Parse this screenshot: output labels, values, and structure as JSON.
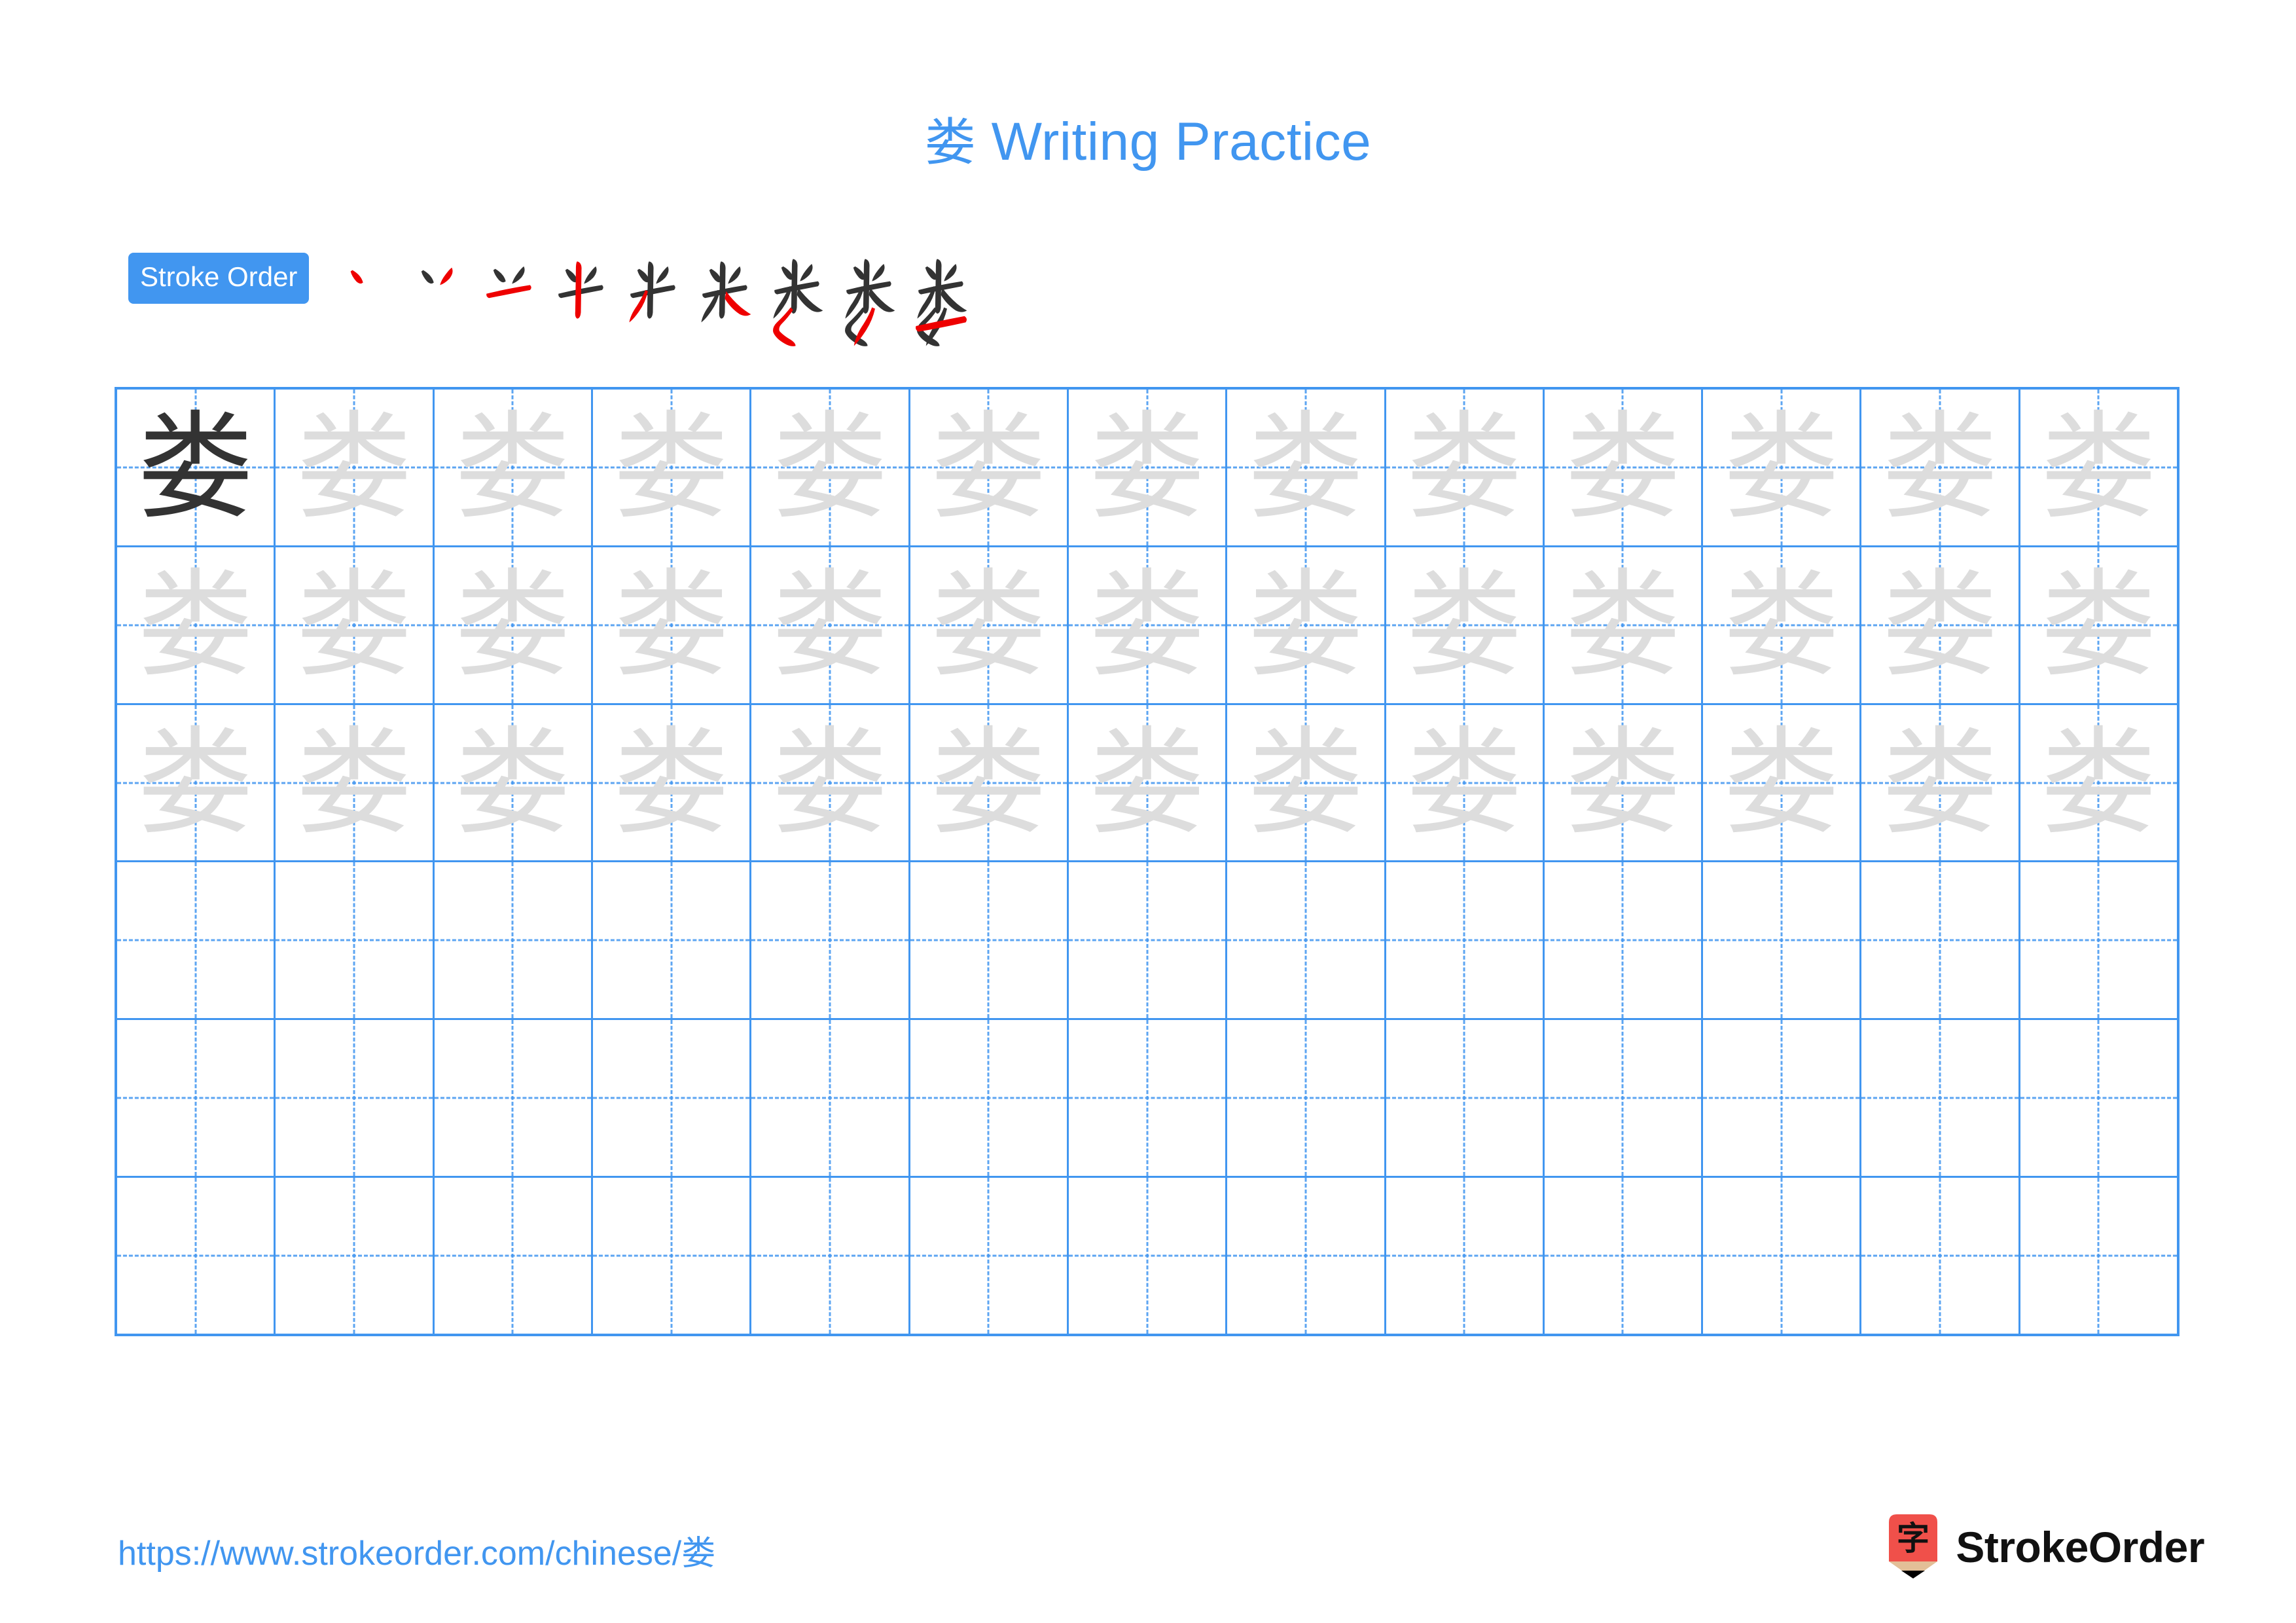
{
  "page": {
    "character": "娄",
    "title_text": "娄 Writing Practice",
    "title_char": "娄",
    "title_suffix": " Writing Practice",
    "accent_color": "#4196f0",
    "stroke_new_color": "#ee0000",
    "stroke_done_color": "#333333",
    "template_char_color": "#dddddd",
    "model_char_color": "#333333"
  },
  "stroke_order": {
    "badge_label": "Stroke Order",
    "total_strokes": 9,
    "steps": [
      {
        "index": 1,
        "label": "stroke-1",
        "new_stroke_name": "dian"
      },
      {
        "index": 2,
        "label": "stroke-2",
        "new_stroke_name": "dian"
      },
      {
        "index": 3,
        "label": "stroke-3",
        "new_stroke_name": "heng"
      },
      {
        "index": 4,
        "label": "stroke-4",
        "new_stroke_name": "shu"
      },
      {
        "index": 5,
        "label": "stroke-5",
        "new_stroke_name": "pie"
      },
      {
        "index": 6,
        "label": "stroke-6",
        "new_stroke_name": "na"
      },
      {
        "index": 7,
        "label": "stroke-7",
        "new_stroke_name": "pie-dian"
      },
      {
        "index": 8,
        "label": "stroke-8",
        "new_stroke_name": "pie"
      },
      {
        "index": 9,
        "label": "stroke-9",
        "new_stroke_name": "heng"
      }
    ]
  },
  "grid": {
    "columns": 13,
    "rows": 6,
    "cells": [
      [
        "dark",
        "faint",
        "faint",
        "faint",
        "faint",
        "faint",
        "faint",
        "faint",
        "faint",
        "faint",
        "faint",
        "faint",
        "faint"
      ],
      [
        "faint",
        "faint",
        "faint",
        "faint",
        "faint",
        "faint",
        "faint",
        "faint",
        "faint",
        "faint",
        "faint",
        "faint",
        "faint"
      ],
      [
        "faint",
        "faint",
        "faint",
        "faint",
        "faint",
        "faint",
        "faint",
        "faint",
        "faint",
        "faint",
        "faint",
        "faint",
        "faint"
      ],
      [
        "blank",
        "blank",
        "blank",
        "blank",
        "blank",
        "blank",
        "blank",
        "blank",
        "blank",
        "blank",
        "blank",
        "blank",
        "blank"
      ],
      [
        "blank",
        "blank",
        "blank",
        "blank",
        "blank",
        "blank",
        "blank",
        "blank",
        "blank",
        "blank",
        "blank",
        "blank",
        "blank"
      ],
      [
        "blank",
        "blank",
        "blank",
        "blank",
        "blank",
        "blank",
        "blank",
        "blank",
        "blank",
        "blank",
        "blank",
        "blank",
        "blank"
      ]
    ]
  },
  "footer": {
    "url": "https://www.strokeorder.com/chinese/娄",
    "brand_name": "StrokeOrder",
    "logo_glyph": "字",
    "logo_body_color": "#f0504a",
    "logo_wood_color": "#e3bf97",
    "logo_tip_color": "#000000"
  }
}
